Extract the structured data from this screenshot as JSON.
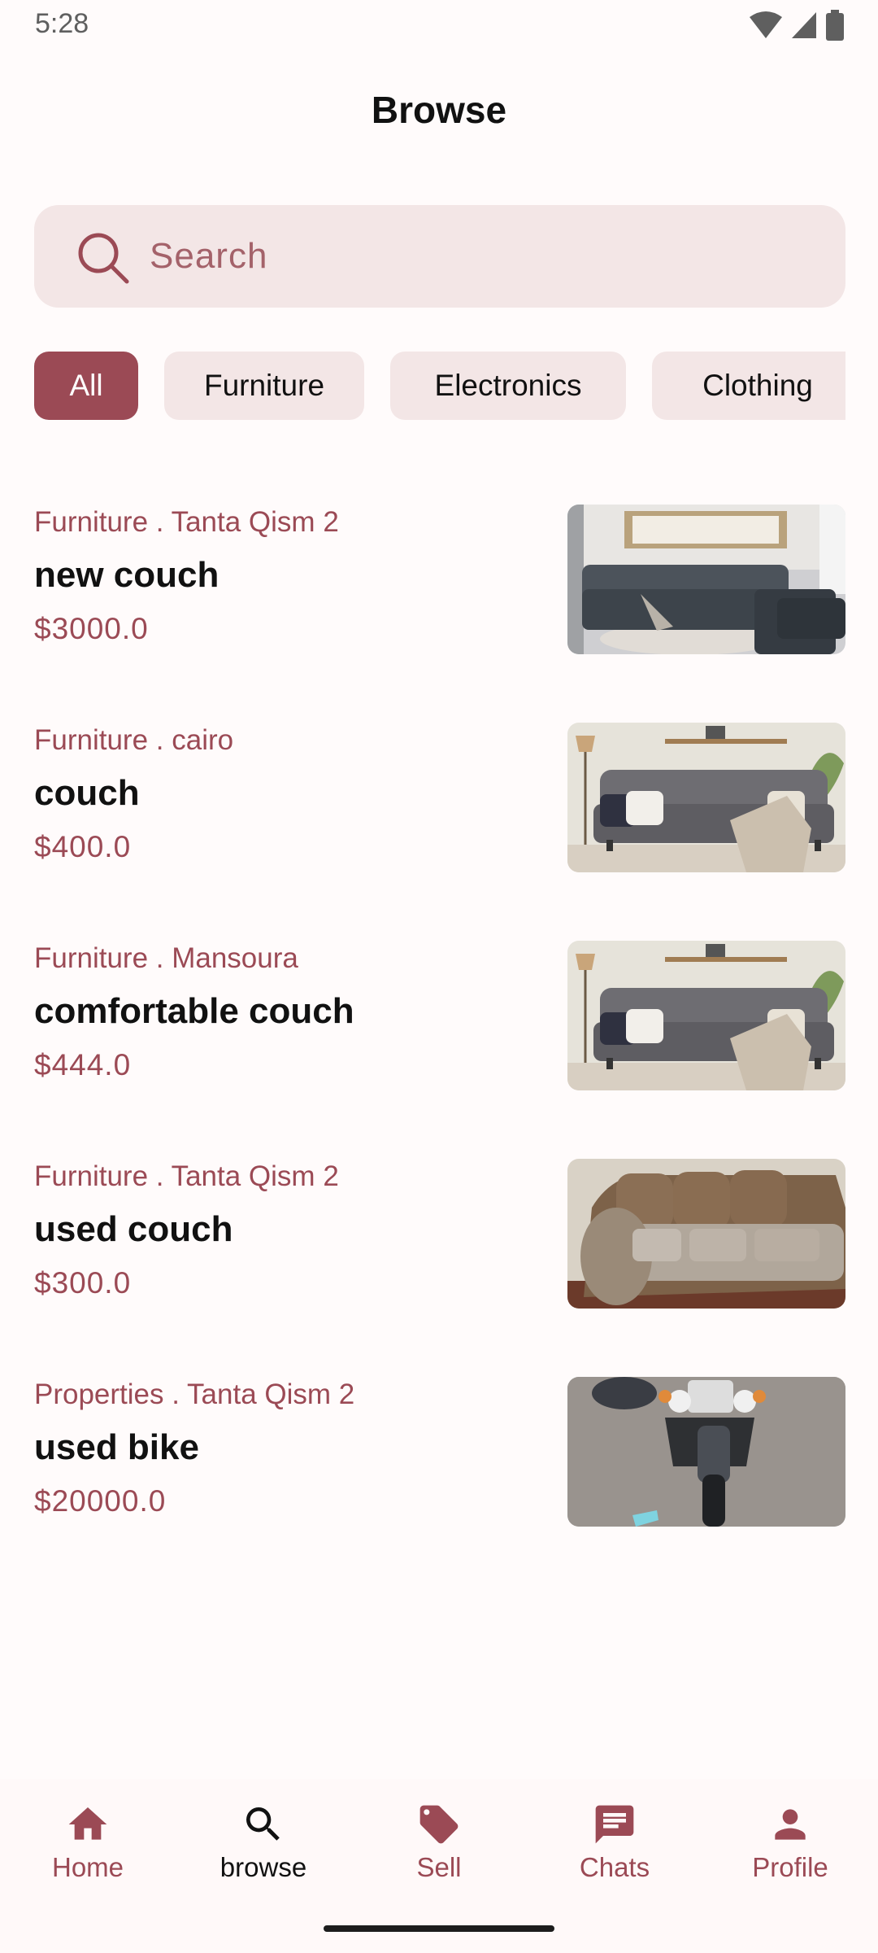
{
  "status_bar": {
    "time": "5:28",
    "icons": [
      "wifi-icon",
      "signal-icon",
      "battery-icon"
    ]
  },
  "header": {
    "title": "Browse"
  },
  "search": {
    "placeholder": "Search",
    "icon": "search-icon"
  },
  "filters": [
    {
      "label": "All",
      "active": true
    },
    {
      "label": "Furniture",
      "active": false
    },
    {
      "label": "Electronics",
      "active": false
    },
    {
      "label": "Clothing",
      "active": false
    }
  ],
  "listings": [
    {
      "meta": "Furniture . Tanta Qism 2",
      "title": "new couch",
      "price": "$3000.0",
      "image": "grey sectional sofa photo"
    },
    {
      "meta": "Furniture . cairo",
      "title": "couch",
      "price": "$400.0",
      "image": "grey sofa with pillows photo"
    },
    {
      "meta": "Furniture . Mansoura",
      "title": "comfortable couch",
      "price": "$444.0",
      "image": "grey sofa with pillows photo"
    },
    {
      "meta": "Furniture . Tanta Qism 2",
      "title": "used couch",
      "price": "$300.0",
      "image": "brown suede sofa photo"
    },
    {
      "meta": "Properties . Tanta Qism 2",
      "title": "used bike",
      "price": "$20000.0",
      "image": "motorcycle photo"
    }
  ],
  "bottom_nav": [
    {
      "label": "Home",
      "icon": "home-icon",
      "active": false
    },
    {
      "label": "browse",
      "icon": "search-icon",
      "active": true
    },
    {
      "label": "Sell",
      "icon": "tag-icon",
      "active": false
    },
    {
      "label": "Chats",
      "icon": "chat-icon",
      "active": false
    },
    {
      "label": "Profile",
      "icon": "person-icon",
      "active": false
    }
  ],
  "colors": {
    "accent": "#9b4a55",
    "chip_bg": "#f3e6e6",
    "background": "#fffbfb",
    "text": "#111111"
  }
}
